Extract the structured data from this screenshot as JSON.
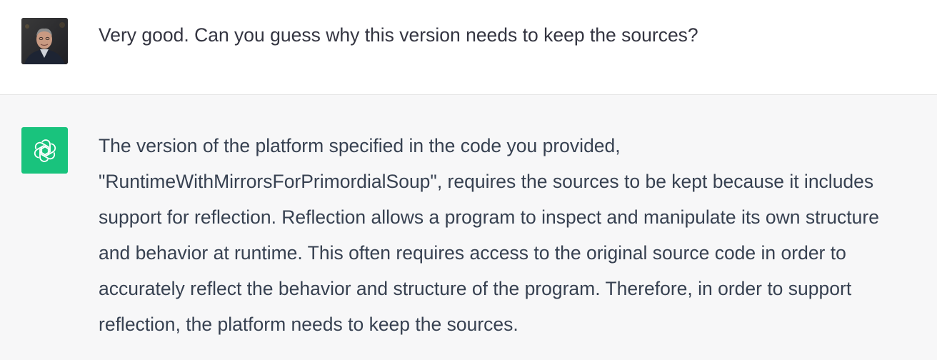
{
  "conversation": {
    "user_message": {
      "avatar_icon": "user-photo-avatar",
      "text": "Very good. Can you guess why this version needs to keep the sources?"
    },
    "assistant_message": {
      "avatar_icon": "openai-logo-icon",
      "avatar_color": "#19c37d",
      "text": "The version of the platform specified in the code you provided, \"RuntimeWithMirrorsForPrimordialSoup\", requires the sources to be kept because it includes support for reflection. Reflection allows a program to inspect and manipulate its own structure and behavior at runtime. This often requires access to the original source code in order to accurately reflect the behavior and structure of the program. Therefore, in order to support reflection, the platform needs to keep the sources."
    }
  }
}
